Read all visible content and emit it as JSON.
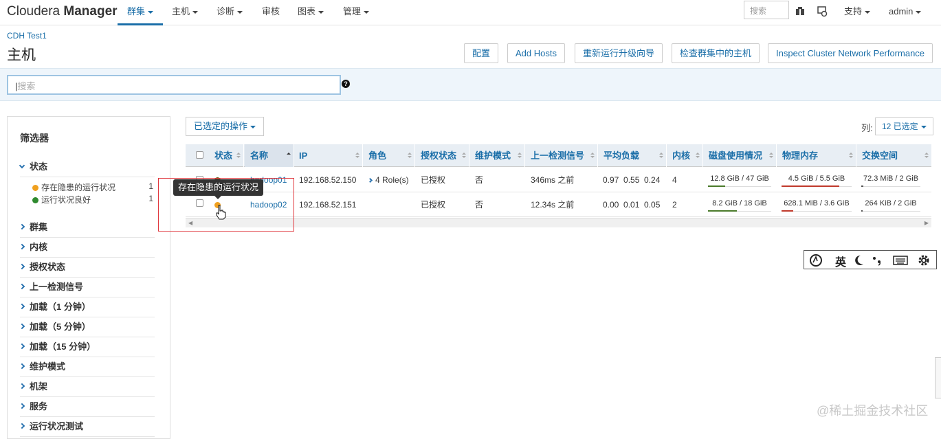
{
  "brand": {
    "light": "Cloudera ",
    "bold": "Manager"
  },
  "nav": [
    {
      "label": "群集",
      "active": true
    },
    {
      "label": "主机",
      "active": false
    },
    {
      "label": "诊断",
      "active": false
    },
    {
      "label": "审核",
      "active": false
    },
    {
      "label": "图表",
      "active": false
    },
    {
      "label": "管理",
      "active": false
    }
  ],
  "top_right": {
    "search_placeholder": "搜索",
    "support": "支持",
    "user": "admin"
  },
  "breadcrumb": "CDH Test1",
  "page_title": "主机",
  "header_buttons": [
    "配置",
    "Add Hosts",
    "重新运行升级向导",
    "检查群集中的主机",
    "Inspect Cluster Network Performance"
  ],
  "search": {
    "placeholder": "搜索",
    "help": "?"
  },
  "filters": {
    "title": "筛选器",
    "status_section": "状态",
    "status_items": [
      {
        "label": "存在隐患的运行状况",
        "count": "1",
        "color": "#f0a01e"
      },
      {
        "label": "运行状况良好",
        "count": "1",
        "color": "#2f8a2f"
      }
    ],
    "sections": [
      "群集",
      "内核",
      "授权状态",
      "上一检测信号",
      "加载（1 分钟）",
      "加载（5 分钟）",
      "加载（15 分钟）",
      "维护模式",
      "机架",
      "服务",
      "运行状况测试"
    ]
  },
  "table": {
    "actions_label": "已选定的操作",
    "columns_label": "列:",
    "columns_selected": "12 已选定",
    "headers": [
      "状态",
      "名称",
      "IP",
      "角色",
      "授权状态",
      "维护模式",
      "上一检测信号",
      "平均负载",
      "内核",
      "磁盘使用情况",
      "物理内存",
      "交换空间"
    ],
    "rows": [
      {
        "status_color": "#6b5a1e",
        "name": "hadoop01",
        "ip": "192.168.52.150",
        "roles": "4 Role(s)",
        "auth": "已授权",
        "maint": "否",
        "heartbeat": "346ms 之前",
        "load": "0.97  0.55  0.24",
        "cores": "4",
        "disk": "12.8 GiB / 47 GiB",
        "disk_pct": 0.27,
        "mem": "4.5 GiB / 5.5 GiB",
        "mem_pct": 0.82,
        "swap": "72.3 MiB / 2 GiB",
        "swap_pct": 0.04
      },
      {
        "status_color": "#f0a01e",
        "name": "hadoop02",
        "ip": "192.168.52.151",
        "roles": "",
        "auth": "已授权",
        "maint": "否",
        "heartbeat": "12.34s 之前",
        "load": "0.00  0.01  0.05",
        "cores": "2",
        "disk": "8.2 GiB / 18 GiB",
        "disk_pct": 0.46,
        "mem": "628.1 MiB / 3.6 GiB",
        "mem_pct": 0.17,
        "swap": "264 KiB / 2 GiB",
        "swap_pct": 0.01
      }
    ]
  },
  "tooltip": "存在隐患的运行状况",
  "ime": {
    "lang": "英"
  },
  "watermark": "@稀土掘金技术社区",
  "colors": {
    "accent": "#1a6ea8",
    "disk_fill": "#4a7a2a",
    "mem_fill": "#c0392b",
    "swap_fill": "#555555"
  }
}
